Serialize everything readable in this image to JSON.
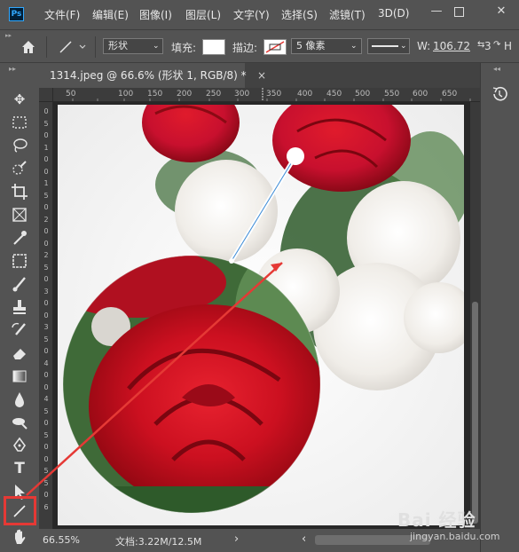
{
  "app": {
    "logo": "Ps",
    "menus": [
      "文件(F)",
      "编辑(E)",
      "图像(I)",
      "图层(L)",
      "文字(Y)",
      "选择(S)",
      "滤镜(T)",
      "3D(D)"
    ],
    "window_controls": [
      "minimize-icon",
      "restore-icon",
      "close-icon"
    ]
  },
  "options": {
    "mode": "形状",
    "fill_label": "填充:",
    "stroke_label": "描边:",
    "stroke_width": "5 像素",
    "width_label": "W:",
    "width_value": "106.72",
    "link_label": "3",
    "height_label": "H"
  },
  "tab": {
    "title": "1314.jpeg @ 66.6% (形状 1, RGB/8) *",
    "close": "×"
  },
  "ruler_top": [
    "50",
    "100",
    "150",
    "200",
    "250",
    "300",
    "350",
    "400",
    "450",
    "500",
    "550",
    "600",
    "650"
  ],
  "ruler_left": [
    "0",
    "5",
    "0",
    "1",
    "0",
    "0",
    "1",
    "5",
    "0",
    "2",
    "0",
    "0",
    "2",
    "5",
    "0",
    "3",
    "0",
    "0",
    "3",
    "5",
    "0",
    "4",
    "0",
    "0",
    "4",
    "5",
    "0",
    "5",
    "0",
    "0",
    "5",
    "5",
    "0",
    "6"
  ],
  "status": {
    "zoom": "66.55%",
    "doc_info": "文档:3.22M/12.5M",
    "arrow": "›"
  },
  "tools": [
    "move-icon",
    "marquee-icon",
    "lasso-icon",
    "quick-select-icon",
    "crop-icon",
    "frame-icon",
    "eyedropper-icon",
    "healing-icon",
    "brush-icon",
    "stamp-icon",
    "history-brush-icon",
    "eraser-icon",
    "gradient-icon",
    "blur-icon",
    "dodge-icon",
    "pen-icon",
    "type-icon",
    "path-select-icon",
    "line-icon",
    "hand-icon"
  ],
  "watermark": {
    "brand": "Bai 经验",
    "url": "jingyan.baidu.com"
  },
  "colors": {
    "accent": "#31a8ff",
    "highlight": "#e53935",
    "rose": "#c8102e",
    "line": "#ffffff"
  }
}
